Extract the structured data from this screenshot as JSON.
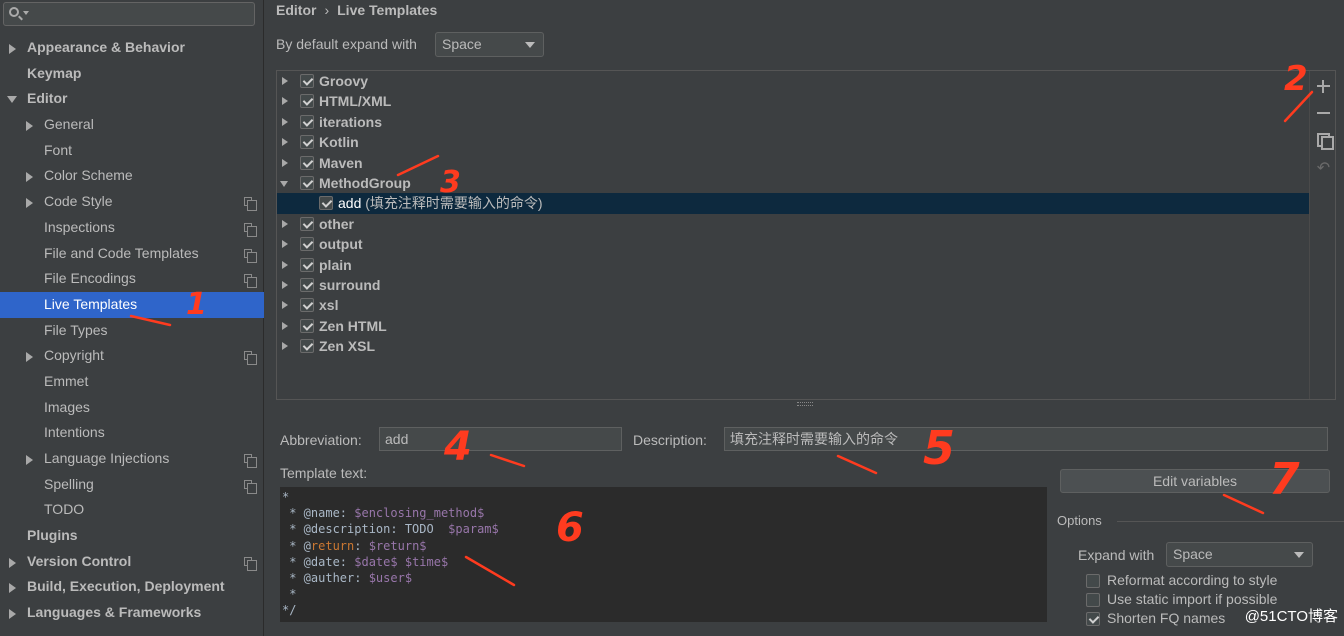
{
  "search": {
    "value": "",
    "placeholder": ""
  },
  "sidebar": {
    "items": [
      {
        "label": "Appearance & Behavior",
        "level": 0,
        "arrow": "right",
        "copy": false,
        "selected": false
      },
      {
        "label": "Keymap",
        "level": 0,
        "arrow": "none",
        "copy": false,
        "selected": false
      },
      {
        "label": "Editor",
        "level": 0,
        "arrow": "down",
        "copy": false,
        "selected": false
      },
      {
        "label": "General",
        "level": 1,
        "arrow": "right",
        "copy": false,
        "selected": false
      },
      {
        "label": "Font",
        "level": 1,
        "arrow": "none",
        "copy": false,
        "selected": false
      },
      {
        "label": "Color Scheme",
        "level": 1,
        "arrow": "right",
        "copy": false,
        "selected": false
      },
      {
        "label": "Code Style",
        "level": 1,
        "arrow": "right",
        "copy": true,
        "selected": false
      },
      {
        "label": "Inspections",
        "level": 1,
        "arrow": "none",
        "copy": true,
        "selected": false
      },
      {
        "label": "File and Code Templates",
        "level": 1,
        "arrow": "none",
        "copy": true,
        "selected": false
      },
      {
        "label": "File Encodings",
        "level": 1,
        "arrow": "none",
        "copy": true,
        "selected": false
      },
      {
        "label": "Live Templates",
        "level": 1,
        "arrow": "none",
        "copy": false,
        "selected": true
      },
      {
        "label": "File Types",
        "level": 1,
        "arrow": "none",
        "copy": false,
        "selected": false
      },
      {
        "label": "Copyright",
        "level": 1,
        "arrow": "right",
        "copy": true,
        "selected": false
      },
      {
        "label": "Emmet",
        "level": 1,
        "arrow": "none",
        "copy": false,
        "selected": false
      },
      {
        "label": "Images",
        "level": 1,
        "arrow": "none",
        "copy": false,
        "selected": false
      },
      {
        "label": "Intentions",
        "level": 1,
        "arrow": "none",
        "copy": false,
        "selected": false
      },
      {
        "label": "Language Injections",
        "level": 1,
        "arrow": "right",
        "copy": true,
        "selected": false
      },
      {
        "label": "Spelling",
        "level": 1,
        "arrow": "none",
        "copy": true,
        "selected": false
      },
      {
        "label": "TODO",
        "level": 1,
        "arrow": "none",
        "copy": false,
        "selected": false
      },
      {
        "label": "Plugins",
        "level": 0,
        "arrow": "none",
        "copy": false,
        "selected": false
      },
      {
        "label": "Version Control",
        "level": 0,
        "arrow": "right",
        "copy": true,
        "selected": false
      },
      {
        "label": "Build, Execution, Deployment",
        "level": 0,
        "arrow": "right",
        "copy": false,
        "selected": false
      },
      {
        "label": "Languages & Frameworks",
        "level": 0,
        "arrow": "right",
        "copy": false,
        "selected": false
      }
    ]
  },
  "breadcrumb": {
    "parent": "Editor",
    "sep": "›",
    "current": "Live Templates"
  },
  "expand_default": {
    "label": "By default expand with",
    "value": "Space"
  },
  "tree": {
    "groups": [
      {
        "name": "Groovy",
        "expanded": false,
        "checked": true
      },
      {
        "name": "HTML/XML",
        "expanded": false,
        "checked": true
      },
      {
        "name": "iterations",
        "expanded": false,
        "checked": true
      },
      {
        "name": "Kotlin",
        "expanded": false,
        "checked": true
      },
      {
        "name": "Maven",
        "expanded": false,
        "checked": true
      },
      {
        "name": "MethodGroup",
        "expanded": true,
        "checked": true,
        "children": [
          {
            "name": "add",
            "description": " (填充注释时需要输入的命令)",
            "checked": true
          }
        ]
      },
      {
        "name": "other",
        "expanded": false,
        "checked": true
      },
      {
        "name": "output",
        "expanded": false,
        "checked": true
      },
      {
        "name": "plain",
        "expanded": false,
        "checked": true
      },
      {
        "name": "surround",
        "expanded": false,
        "checked": true
      },
      {
        "name": "xsl",
        "expanded": false,
        "checked": true
      },
      {
        "name": "Zen HTML",
        "expanded": false,
        "checked": true
      },
      {
        "name": "Zen XSL",
        "expanded": false,
        "checked": true
      }
    ]
  },
  "toolbar": {
    "undo_glyph": "↶"
  },
  "form": {
    "abbreviation_label": "Abbreviation:",
    "abbreviation_value": "add",
    "description_label": "Description:",
    "description_value": "填充注释时需要输入的命令",
    "template_label": "Template text:",
    "template_lines": [
      [
        {
          "t": "*",
          "c": ""
        }
      ],
      [
        {
          "t": " * @name: ",
          "c": ""
        },
        {
          "t": "$enclosing_method$",
          "c": "tv"
        }
      ],
      [
        {
          "t": " * @description: TODO  ",
          "c": ""
        },
        {
          "t": "$param$",
          "c": "tv"
        }
      ],
      [
        {
          "t": " * @",
          "c": ""
        },
        {
          "t": "return",
          "c": "tr"
        },
        {
          "t": ": ",
          "c": ""
        },
        {
          "t": "$return$",
          "c": "tv"
        }
      ],
      [
        {
          "t": " * @date: ",
          "c": ""
        },
        {
          "t": "$date$",
          "c": "tv"
        },
        {
          "t": " ",
          "c": ""
        },
        {
          "t": "$time$",
          "c": "tv"
        }
      ],
      [
        {
          "t": " * @auther: ",
          "c": ""
        },
        {
          "t": "$user$",
          "c": "tv"
        }
      ],
      [
        {
          "t": " *",
          "c": ""
        }
      ],
      [
        {
          "t": "*/",
          "c": ""
        }
      ]
    ],
    "edit_variables_label": "Edit variables",
    "options_title": "Options",
    "expand_with_label": "Expand with",
    "expand_with_value": "Space",
    "reformat_label": "Reformat according to style",
    "reformat_checked": false,
    "static_import_label": "Use static import if possible",
    "static_import_checked": false,
    "shorten_fq_label": "Shorten FQ names",
    "shorten_fq_checked": true
  },
  "annotations": {
    "n1": "1",
    "n2": "2",
    "n3": "3",
    "n4": "4",
    "n5": "5",
    "n6": "6",
    "n7": "7",
    "color": "#ff3b1f"
  },
  "watermark": "@51CTO博客"
}
